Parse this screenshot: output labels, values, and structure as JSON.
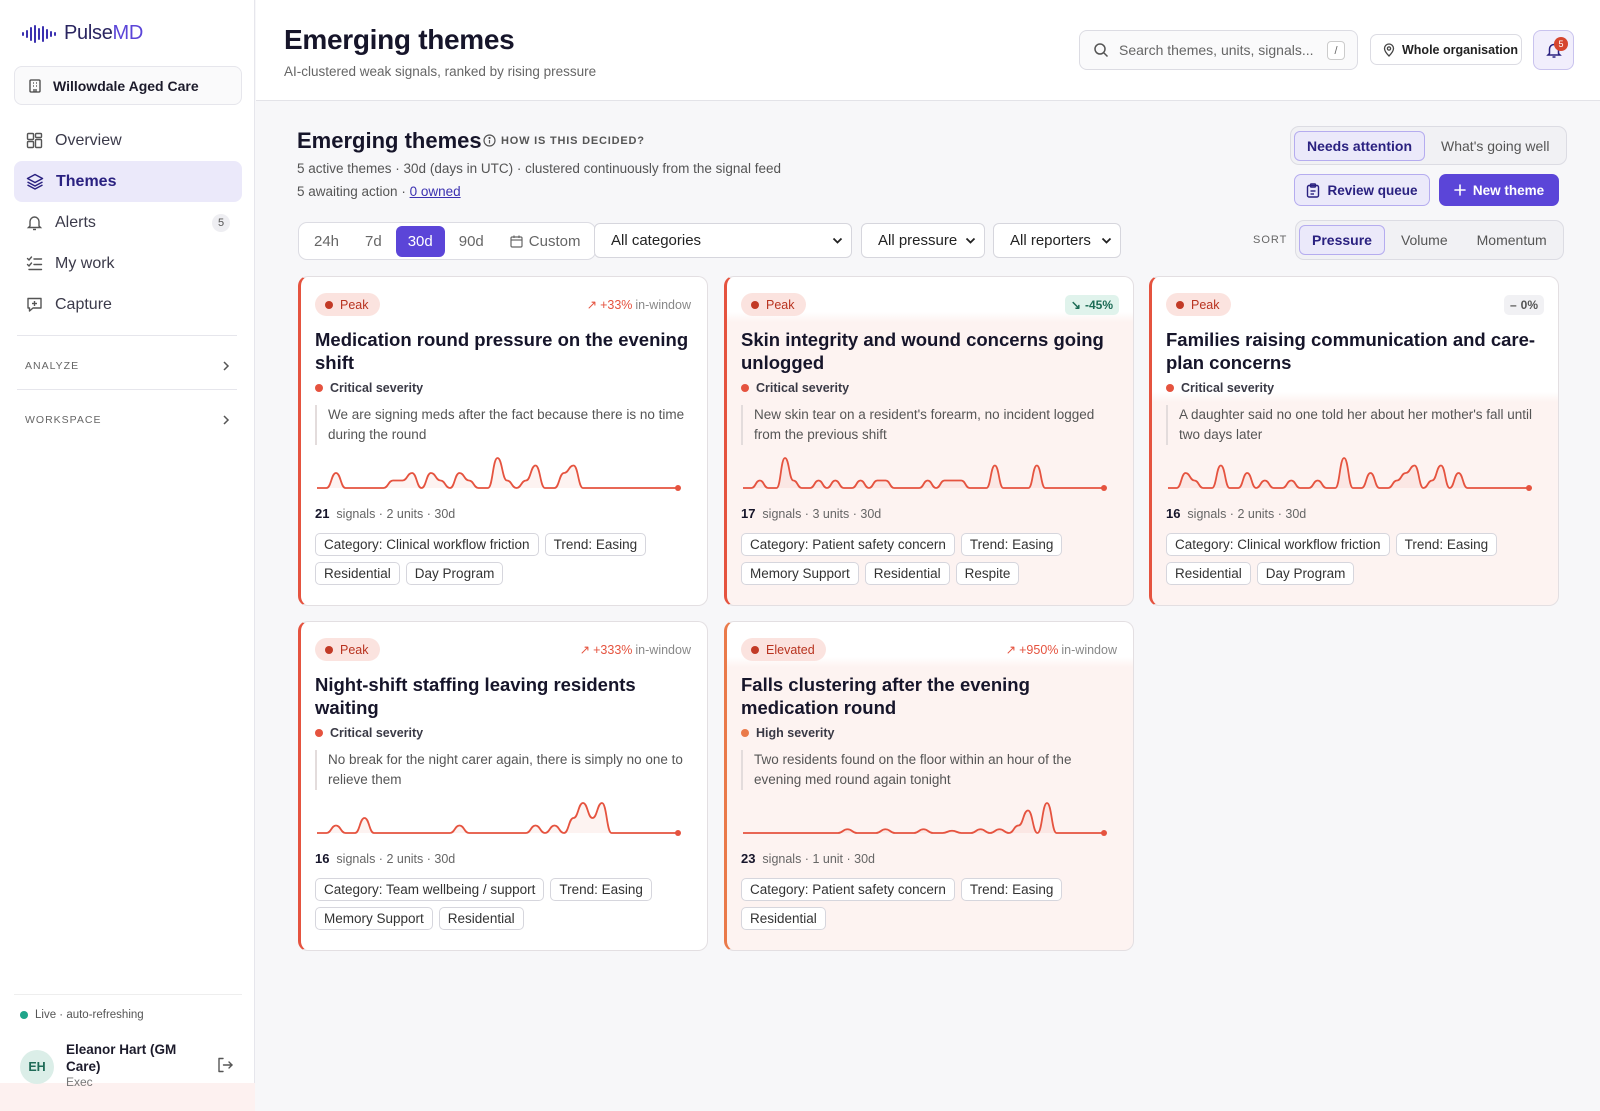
{
  "app": {
    "name_prefix": "Pulse",
    "name_suffix": "MD",
    "org": "Willowdale Aged Care"
  },
  "sidebar": {
    "items": [
      {
        "label": "Overview",
        "icon": "grid-icon"
      },
      {
        "label": "Themes",
        "icon": "layers-icon"
      },
      {
        "label": "Alerts",
        "icon": "bell-icon",
        "badge": "5"
      },
      {
        "label": "My work",
        "icon": "checklist-icon"
      },
      {
        "label": "Capture",
        "icon": "plus-square-icon"
      }
    ],
    "sections": [
      "ANALYZE",
      "WORKSPACE"
    ],
    "live": "Live · auto-refreshing",
    "user": {
      "initials": "EH",
      "name": "Eleanor Hart (GM Care)",
      "role": "Exec"
    }
  },
  "header": {
    "title": "Emerging themes",
    "subtitle": "AI-clustered weak signals, ranked by rising pressure",
    "search_placeholder": "Search themes, units, signals...",
    "search_kbd": "/",
    "scope": "Whole organisation",
    "notif_count": "5"
  },
  "main": {
    "title": "Emerging themes",
    "how": "HOW IS THIS DECIDED?",
    "meta1": "5 active themes · 30d (days in UTC) · clustered continuously from the signal feed",
    "meta2_prefix": "5 awaiting action · ",
    "meta2_link": "0 owned",
    "view_toggle": [
      "Needs attention",
      "What's going well"
    ],
    "review_queue": "Review queue",
    "new_theme": "New theme",
    "ranges": [
      "24h",
      "7d",
      "30d",
      "90d",
      "Custom"
    ],
    "active_range": "30d",
    "filters": {
      "category": "All categories",
      "pressure": "All pressure",
      "reporters": "All reporters"
    },
    "sort_label": "SORT",
    "sort_options": [
      "Pressure",
      "Volume",
      "Momentum"
    ],
    "active_sort": "Pressure"
  },
  "colors": {
    "accent": "#5b45d8",
    "critical": "#e5533f",
    "high": "#ea7a4a",
    "spark": "#e5533f"
  },
  "cards": [
    {
      "level": "Peak",
      "trend": "+33%",
      "trend_suffix": "in-window",
      "title": "Medication round pressure on the evening shift",
      "severity": "Critical severity",
      "quote": "We are signing meds after the fact because there is no time during the round",
      "signals": "21",
      "stats_rest": "signals · 2 units · 30d",
      "tags": [
        "Category: Clinical workflow friction",
        "Trend: Easing",
        "Residential",
        "Day Program"
      ],
      "spark": [
        1,
        1,
        3,
        1,
        1,
        1,
        1,
        1,
        2,
        2,
        3,
        1,
        3,
        2,
        1,
        3,
        2,
        1,
        1,
        5,
        2,
        1,
        2,
        4,
        1,
        1,
        3,
        4,
        1,
        1,
        1,
        1,
        1,
        1,
        1,
        1,
        1,
        1,
        1
      ]
    },
    {
      "level": "Peak",
      "trend": "-45%",
      "title": "Skin integrity and wound concerns going unlogged",
      "severity": "Critical severity",
      "quote": "New skin tear on a resident's forearm, no incident logged from the previous shift",
      "signals": "17",
      "stats_rest": "signals · 3 units · 30d",
      "tags": [
        "Category: Patient safety concern",
        "Trend: Easing",
        "Memory Support",
        "Residential",
        "Respite"
      ],
      "spark": [
        1,
        1,
        2,
        1,
        1,
        5,
        2,
        1,
        1,
        2,
        1,
        2,
        1,
        1,
        2,
        1,
        2,
        2,
        1,
        1,
        1,
        1,
        2,
        1,
        2,
        2,
        2,
        1,
        1,
        1,
        4,
        1,
        1,
        1,
        1,
        4,
        1,
        1,
        1,
        1,
        1,
        1,
        1,
        1
      ]
    },
    {
      "level": "Peak",
      "trend": "0%",
      "title": "Families raising communication and care-plan concerns",
      "severity": "Critical severity",
      "quote": "A daughter said no one told her about her mother's fall until two days later",
      "signals": "16",
      "stats_rest": "signals · 2 units · 30d",
      "tags": [
        "Category: Clinical workflow friction",
        "Trend: Easing",
        "Residential",
        "Day Program"
      ],
      "spark": [
        1,
        1,
        3,
        2,
        1,
        1,
        4,
        1,
        1,
        3,
        1,
        2,
        1,
        1,
        2,
        1,
        1,
        2,
        1,
        1,
        5,
        1,
        1,
        3,
        1,
        1,
        2,
        3,
        4,
        1,
        2,
        4,
        1,
        3,
        1,
        1,
        1,
        1,
        1,
        1,
        1,
        1
      ]
    },
    {
      "level": "Peak",
      "trend": "+333%",
      "trend_suffix": "in-window",
      "title": "Night-shift staffing leaving residents waiting",
      "severity": "Critical severity",
      "quote": "No break for the night carer again, there is simply no one to relieve them",
      "signals": "16",
      "stats_rest": "signals · 2 units · 30d",
      "tags": [
        "Category: Team wellbeing / support",
        "Trend: Easing",
        "Memory Support",
        "Residential"
      ],
      "spark": [
        1,
        1,
        2,
        1,
        1,
        3,
        1,
        1,
        1,
        1,
        1,
        1,
        1,
        1,
        1,
        2,
        1,
        1,
        1,
        1,
        1,
        1,
        1,
        2,
        1,
        2,
        1,
        3,
        5,
        3,
        5,
        1,
        1,
        1,
        1,
        1,
        1,
        1,
        1
      ]
    },
    {
      "level": "Elevated",
      "trend": "+950%",
      "trend_suffix": "in-window",
      "title": "Falls clustering after the evening medication round",
      "severity": "High severity",
      "quote": "Two residents found on the floor within an hour of the evening med round again tonight",
      "signals": "23",
      "stats_rest": "signals · 1 unit · 30d",
      "tags": [
        "Category: Patient safety concern",
        "Trend: Easing",
        "Residential"
      ],
      "spark": [
        1,
        1,
        1,
        1,
        1,
        1,
        1,
        1,
        1,
        1,
        1,
        1.5,
        1,
        1,
        1,
        1.5,
        1,
        1,
        1,
        1.5,
        1,
        1,
        1.3,
        1,
        1,
        1.5,
        1,
        1.5,
        1,
        2,
        4,
        1,
        5,
        1,
        1,
        1,
        1,
        1,
        1
      ]
    }
  ]
}
